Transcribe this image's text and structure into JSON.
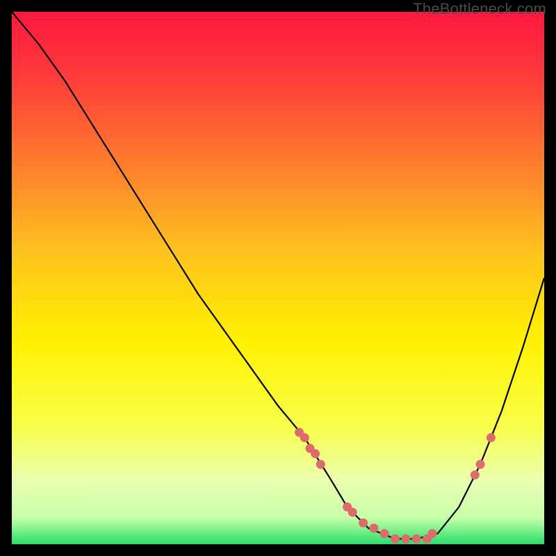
{
  "watermark": "TheBottleneck.com",
  "chart_data": {
    "type": "line",
    "title": "",
    "xlabel": "",
    "ylabel": "",
    "xlim": [
      0,
      100
    ],
    "ylim": [
      0,
      100
    ],
    "grid": false,
    "legend": false,
    "background_gradient": {
      "stops": [
        {
          "offset": 0.0,
          "color": "#ff173e"
        },
        {
          "offset": 0.12,
          "color": "#ff3b3a"
        },
        {
          "offset": 0.28,
          "color": "#ff7a2e"
        },
        {
          "offset": 0.45,
          "color": "#ffc21e"
        },
        {
          "offset": 0.62,
          "color": "#fff200"
        },
        {
          "offset": 0.78,
          "color": "#f8ff4a"
        },
        {
          "offset": 0.88,
          "color": "#eaffb0"
        },
        {
          "offset": 0.95,
          "color": "#c8ffa8"
        },
        {
          "offset": 1.0,
          "color": "#26e06a"
        }
      ]
    },
    "series": [
      {
        "name": "bottleneck-curve",
        "type": "line",
        "color": "#000000",
        "x": [
          0,
          5,
          10,
          15,
          20,
          25,
          30,
          35,
          40,
          45,
          50,
          55,
          60,
          63,
          67,
          72,
          76,
          80,
          84,
          88,
          92,
          96,
          100
        ],
        "values": [
          100,
          94,
          87,
          79,
          71,
          63,
          55,
          47,
          40,
          33,
          26,
          20,
          12,
          7,
          3,
          1,
          1,
          2,
          7,
          15,
          25,
          37,
          50
        ]
      },
      {
        "name": "markers-left-rise",
        "type": "scatter",
        "color": "#dd6b6b",
        "x": [
          54,
          55,
          56,
          57,
          58
        ],
        "values": [
          21,
          20,
          18,
          17,
          15
        ]
      },
      {
        "name": "markers-valley",
        "type": "scatter",
        "color": "#dd6b6b",
        "x": [
          63,
          64,
          66,
          68,
          70,
          72,
          74,
          76,
          78,
          79
        ],
        "values": [
          7,
          6,
          4,
          3,
          2,
          1,
          1,
          1,
          1,
          2
        ]
      },
      {
        "name": "markers-right-rise",
        "type": "scatter",
        "color": "#dd6b6b",
        "x": [
          87,
          88,
          90
        ],
        "values": [
          13,
          15,
          20
        ]
      }
    ]
  }
}
